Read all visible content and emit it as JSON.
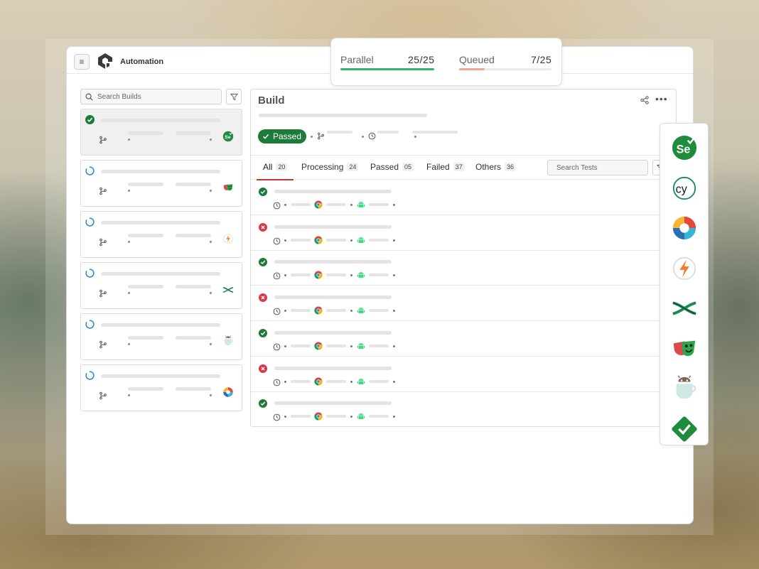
{
  "app": {
    "title": "Automation"
  },
  "left_panel": {
    "search_placeholder": "Search Builds",
    "builds": [
      {
        "status": "passed",
        "framework_icon": "selenium-icon"
      },
      {
        "status": "running",
        "framework_icon": "playwright-icon"
      },
      {
        "status": "running",
        "framework_icon": "jest-icon"
      },
      {
        "status": "running",
        "framework_icon": "xctest-icon"
      },
      {
        "status": "running",
        "framework_icon": "espresso-icon"
      },
      {
        "status": "running",
        "framework_icon": "testcafe-icon"
      }
    ]
  },
  "build": {
    "title": "Build",
    "status_label": "Passed",
    "tabs": [
      {
        "label": "All",
        "count": "20",
        "active": true
      },
      {
        "label": "Processing",
        "count": "24"
      },
      {
        "label": "Passed",
        "count": "05"
      },
      {
        "label": "Failed",
        "count": "37"
      },
      {
        "label": "Others",
        "count": "36"
      }
    ],
    "search_tests_placeholder": "Search Tests",
    "tests": [
      {
        "status": "passed"
      },
      {
        "status": "failed"
      },
      {
        "status": "passed"
      },
      {
        "status": "failed"
      },
      {
        "status": "passed"
      },
      {
        "status": "failed"
      },
      {
        "status": "passed"
      }
    ]
  },
  "parallel_card": {
    "parallel_label": "Parallel",
    "parallel_value": "25/25",
    "parallel_fraction": 1.0,
    "queued_label": "Queued",
    "queued_value": "7/25",
    "queued_fraction": 0.28
  },
  "frameworks": [
    "selenium-icon",
    "cypress-icon",
    "testcafe-icon",
    "jest-icon",
    "xctest-icon",
    "playwright-icon",
    "espresso-icon",
    "webdriverio-icon"
  ],
  "colors": {
    "passed": "#1d7a3a",
    "failed": "#d63a4a",
    "running": "#2f86c9",
    "parallel_bar": "#2bb673",
    "queued_bar": "#f0a79a"
  }
}
